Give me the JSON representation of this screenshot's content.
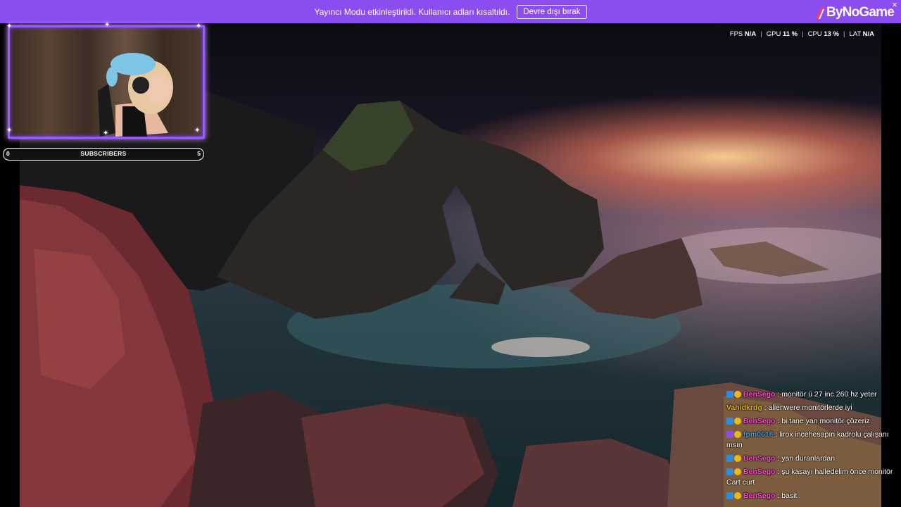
{
  "notice": {
    "text": "Yayıncı Modu etkinleştirildi. Kullanıcı adları kısaltıldı.",
    "button": "Devre dışı bırak"
  },
  "brand": {
    "name": "ByNoGame",
    "close": "×"
  },
  "stats": [
    {
      "label": "FPS",
      "value": "N/A"
    },
    {
      "label": "GPU",
      "value": "11 %"
    },
    {
      "label": "CPU",
      "value": "13 %"
    },
    {
      "label": "LAT",
      "value": "N/A"
    }
  ],
  "subscribers": {
    "label": "SUBSCRIBERS",
    "current": "0",
    "goal": "5"
  },
  "chat": [
    {
      "user": "BenSego",
      "color": "#ff44d2",
      "badges": [
        "blue",
        "gold"
      ],
      "text": ": monitör ü 27 inc 260 hz yeter"
    },
    {
      "user": "Vahidkrdg",
      "color": "#e6b400",
      "badges": [],
      "text": ": alienwere monitörlerde iyi"
    },
    {
      "user": "BenSego",
      "color": "#ff44d2",
      "badges": [
        "blue",
        "gold"
      ],
      "text": ": bi tane yan monitör çözeriz"
    },
    {
      "user": "fpm0618",
      "color": "#3a9ad9",
      "badges": [
        "purple",
        "gold"
      ],
      "text": ": lirox incehesapın kadrolu çalışanı msın"
    },
    {
      "user": "BenSego",
      "color": "#ff44d2",
      "badges": [
        "blue",
        "gold"
      ],
      "text": ": yan duranlardan"
    },
    {
      "user": "BenSego",
      "color": "#ff44d2",
      "badges": [
        "blue",
        "gold"
      ],
      "text": ": şu kasayı halledelim önce monitör Cart curt"
    },
    {
      "user": "BenSego",
      "color": "#ff44d2",
      "badges": [
        "blue",
        "gold"
      ],
      "text": ": basit"
    }
  ],
  "colors": {
    "accent": "#8b4cf0",
    "frame": "#9b5cff"
  }
}
